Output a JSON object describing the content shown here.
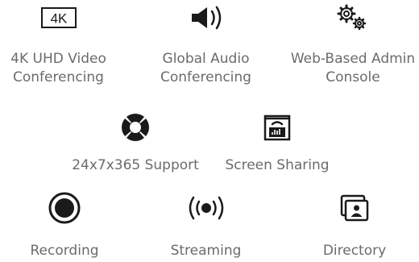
{
  "features": {
    "uhd": {
      "icon": "4k-icon",
      "badge": "4K",
      "line1": "4K UHD Video",
      "line2": "Conferencing"
    },
    "audio": {
      "icon": "speaker-icon",
      "line1": "Global Audio",
      "line2": "Conferencing"
    },
    "admin": {
      "icon": "gears-icon",
      "line1": "Web-Based Admin",
      "line2": "Console"
    },
    "support": {
      "icon": "lifebuoy-icon",
      "line1": "24x7x365 Support"
    },
    "sharing": {
      "icon": "screen-share-icon",
      "line1": "Screen Sharing"
    },
    "recording": {
      "icon": "record-icon",
      "line1": "Recording"
    },
    "streaming": {
      "icon": "broadcast-icon",
      "line1": "Streaming"
    },
    "directory": {
      "icon": "contact-card-icon",
      "line1": "Directory"
    }
  },
  "colors": {
    "icon": "#1a1a1a",
    "text": "#6b6b6b"
  }
}
